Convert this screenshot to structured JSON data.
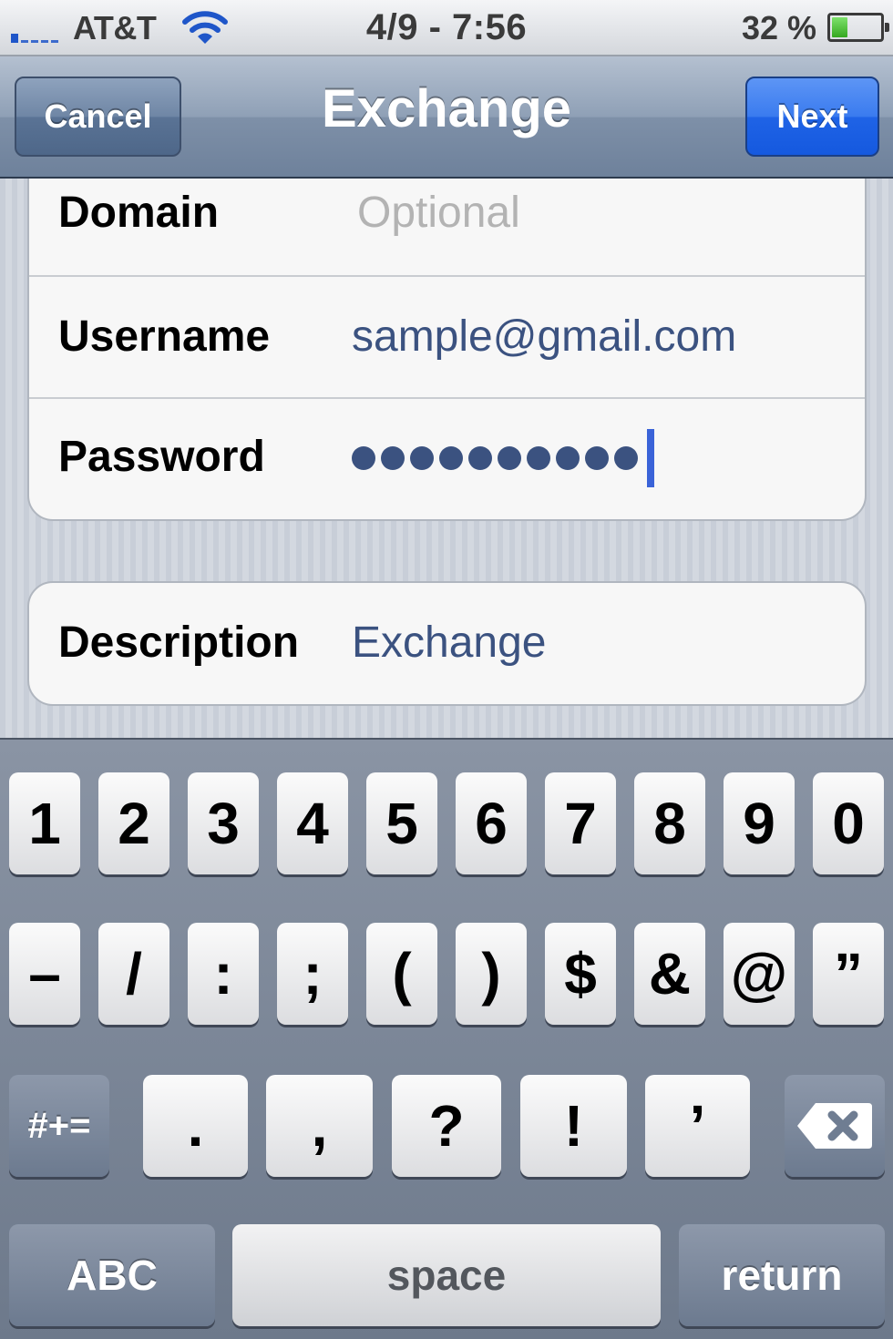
{
  "status_bar": {
    "carrier": "AT&T",
    "time": "4/9 - 7:56",
    "battery_percent": "32 %",
    "battery_level": 0.32,
    "icons": [
      "signal-icon",
      "wifi-icon",
      "battery-icon"
    ]
  },
  "nav_bar": {
    "cancel_label": "Cancel",
    "title": "Exchange",
    "next_label": "Next"
  },
  "form": {
    "domain_label": "Domain",
    "domain_placeholder": "Optional",
    "username_label": "Username",
    "username_value": "sample@gmail.com",
    "password_label": "Password",
    "password_length": 10,
    "description_label": "Description",
    "description_value": "Exchange"
  },
  "keyboard": {
    "row1": [
      "1",
      "2",
      "3",
      "4",
      "5",
      "6",
      "7",
      "8",
      "9",
      "0"
    ],
    "row2": [
      "–",
      "/",
      ":",
      ";",
      "(",
      ")",
      "$",
      "&",
      "@",
      "”"
    ],
    "row3": [
      "#+=",
      ".",
      ",",
      "?",
      "!",
      "’"
    ],
    "delete_icon": "delete-icon",
    "abc_label": "ABC",
    "space_label": "space",
    "return_label": "return"
  },
  "colors": {
    "next_button": "#1f63e6",
    "input_text": "#3b5280",
    "cursor": "#3a63d8"
  }
}
